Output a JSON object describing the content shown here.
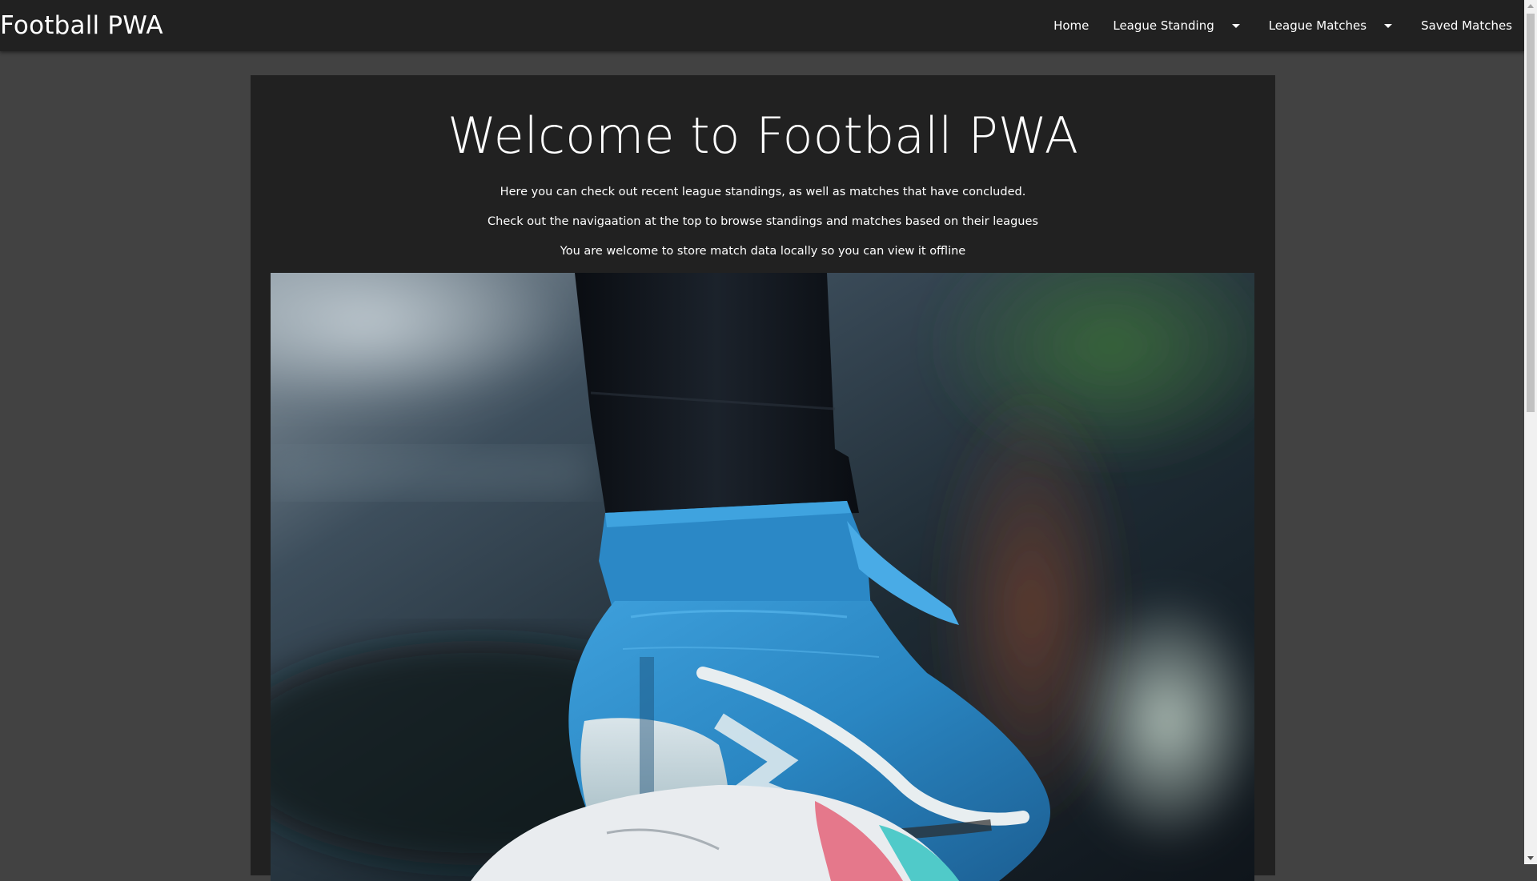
{
  "navbar": {
    "brand": "Football PWA",
    "items": [
      {
        "label": "Home",
        "dropdown": false
      },
      {
        "label": "League Standing",
        "dropdown": true
      },
      {
        "label": "League Matches",
        "dropdown": true
      },
      {
        "label": "Saved Matches",
        "dropdown": false
      }
    ]
  },
  "main": {
    "title": "Welcome to Football PWA",
    "paragraphs": [
      "Here you can check out recent league standings, as well as matches that have concluded.",
      "Check out the navigaation at the top to browse standings and matches based on their leagues",
      "You are welcome to store match data locally so you can view it offline"
    ],
    "hero_image": "football-boot-on-ball-photo"
  },
  "colors": {
    "page_bg": "#424242",
    "navbar_bg": "#212121",
    "card_bg": "#212121",
    "text": "#ffffff",
    "boot_blue": "#2f8fc9"
  }
}
